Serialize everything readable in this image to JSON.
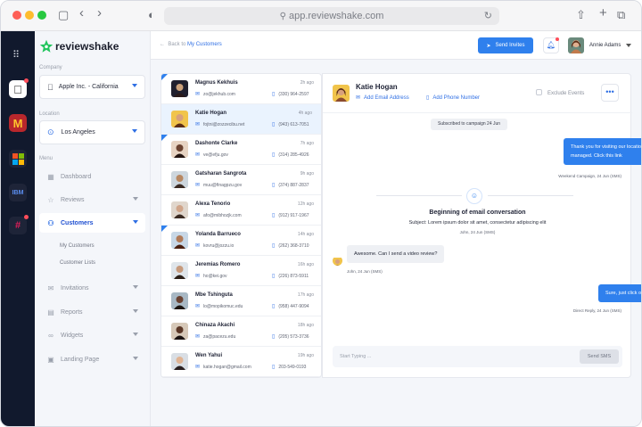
{
  "browser": {
    "url": "app.reviewshake.com"
  },
  "sidebar": {
    "brand": "reviewshake",
    "company_label": "Company",
    "company_value": "Apple Inc. - California",
    "location_label": "Location",
    "location_value": "Los Angeles",
    "menu_label": "Menu",
    "items": [
      {
        "label": "Dashboard"
      },
      {
        "label": "Reviews"
      },
      {
        "label": "Customers"
      },
      {
        "label": "Invitations"
      },
      {
        "label": "Reports"
      },
      {
        "label": "Widgets"
      },
      {
        "label": "Landing Page"
      }
    ],
    "sub_items": [
      {
        "label": "My Customers"
      },
      {
        "label": "Customer Lists"
      }
    ]
  },
  "rail": {
    "apps": [
      "apple",
      "mcdonalds",
      "microsoft",
      "ibm",
      "slack"
    ]
  },
  "header": {
    "back_prefix": "Back to",
    "back_link": "My Customers",
    "send_invites": "Send Invites",
    "user_name": "Annie Adams"
  },
  "contacts": [
    {
      "name": "Magnus Kekhuis",
      "email": "zo@jekhub.com",
      "phone": "(330) 964-2597",
      "time": "2h ago"
    },
    {
      "name": "Katie Hogan",
      "email": "fojtni@zozzecibu.net",
      "phone": "(943) 613-7051",
      "time": "4h ago"
    },
    {
      "name": "Dashonte Clarke",
      "email": "ve@efju.gov",
      "phone": "(314) 285-4926",
      "time": "7h ago"
    },
    {
      "name": "Gatsharan Sangrota",
      "email": "muu@finagpzu.gov",
      "phone": "(374) 887-2837",
      "time": "9h ago"
    },
    {
      "name": "Alexa Tenorio",
      "email": "afo@mibhozjk.com",
      "phone": "(912) 917-1967",
      "time": "12h ago"
    },
    {
      "name": "Yolanda Barrueco",
      "email": "kovru@jozzu.io",
      "phone": "(262) 368-3710",
      "time": "14h ago"
    },
    {
      "name": "Jeremias Romero",
      "email": "ho@kei.gov",
      "phone": "(226) 873-5911",
      "time": "16h ago"
    },
    {
      "name": "Mbe Tshinguta",
      "email": "lo@mopikomuc.edu",
      "phone": "(958) 447-9094",
      "time": "17h ago"
    },
    {
      "name": "Chinaza Akachi",
      "email": "za@pacezu.edu",
      "phone": "(205) 573-3736",
      "time": "18h ago"
    },
    {
      "name": "Wen Yahui",
      "email": "katie.hogan@gmail.com",
      "phone": "203-549-0193",
      "time": "19h ago"
    }
  ],
  "chat": {
    "contact_name": "Katie Hogan",
    "add_email": "Add Email Address",
    "add_phone": "Add Phone Number",
    "exclude_events": "Exclude Events",
    "subscribed_pill": "Subscribed to campaign 24 Jun",
    "msg1": "Thank you for visiting our location yesterday. Please leave us a review to tell us how we managed. Click this link",
    "msg1_meta": "Weekend Campaign, 24 Jun (SMS)",
    "email_title": "Beginning of email conversation",
    "email_subject": "Subject: Lorem ipsum dolor sit amet, consectetur adipiscing elit",
    "email_meta": "John, 24 Jun (SMS)",
    "msg2": "Awesome. Can I send a video review?",
    "msg2_meta": "John, 24 Jun (SMS)",
    "msg3": "Sure, just click on the top option on the review us landing page.",
    "msg3_meta": "Direct Reply, 24 Jun (SMS)",
    "input_placeholder": "Start Typing ...",
    "send_sms": "Send SMS"
  },
  "colors": {
    "accent": "#2f80ed",
    "rail": "#11192d"
  }
}
